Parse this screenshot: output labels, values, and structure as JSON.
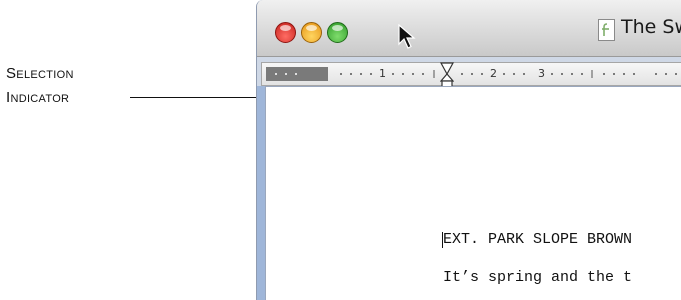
{
  "callout": {
    "line1": "Selection",
    "line2": "Indicator"
  },
  "window": {
    "title": "The Sw",
    "buttons": [
      "close",
      "minimize",
      "zoom"
    ]
  },
  "ruler": {
    "numbers": [
      "1",
      "2",
      "3"
    ]
  },
  "script": {
    "line1": "EXT. PARK SLOPE BROWN",
    "line2": "It’s spring and the t"
  }
}
